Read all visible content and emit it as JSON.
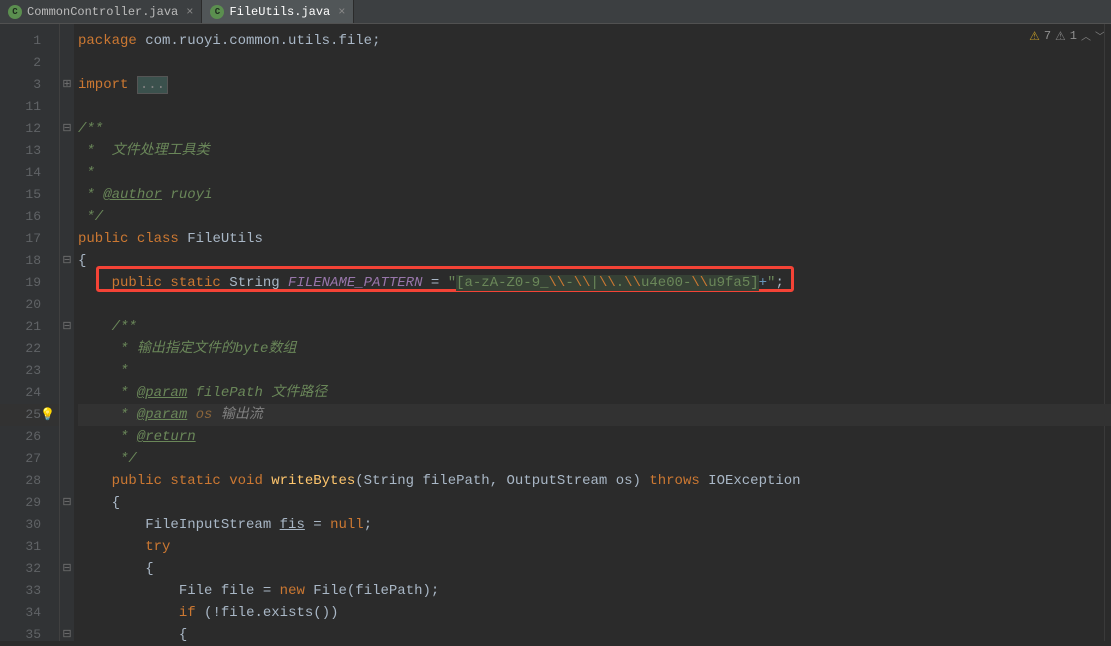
{
  "tabs": [
    {
      "name": "CommonController.java",
      "active": false
    },
    {
      "name": "FileUtils.java",
      "active": true
    }
  ],
  "inspections": {
    "warn7": "7",
    "warn1": "1"
  },
  "gutter": [
    "1",
    "2",
    "3",
    "11",
    "12",
    "13",
    "14",
    "15",
    "16",
    "17",
    "18",
    "19",
    "20",
    "21",
    "22",
    "23",
    "24",
    "25",
    "26",
    "27",
    "28",
    "29",
    "30",
    "31",
    "32",
    "33",
    "34",
    "35"
  ],
  "code": {
    "pkg_kw": "package ",
    "pkg_name": "com.ruoyi.common.utils.file",
    "semicolon": ";",
    "import_kw": "import ",
    "import_folded": "...",
    "doc_open": "/**",
    "doc_l1": " *  文件处理工具类",
    "doc_star": " *",
    "doc_author_pre": " * ",
    "doc_author_tag": "@author",
    "doc_author_val": " ruoyi",
    "doc_close": " */",
    "public": "public ",
    "class": "class ",
    "classname": "FileUtils",
    "lbrace": "{",
    "rbrace": "}",
    "static": "static ",
    "string_t": "String ",
    "field_name": "FILENAME_PATTERN",
    "eq": " = ",
    "regex_q1": "\"",
    "regex_p1": "[a-zA-Z0-9_",
    "regex_e1": "\\\\",
    "regex_p2": "-",
    "regex_e2": "\\\\",
    "regex_p3": "|",
    "regex_e3": "\\\\",
    "regex_p4": ".",
    "regex_e4": "\\\\",
    "regex_p5": "u4e00-",
    "regex_e5": "\\\\",
    "regex_p6": "u9fa5]",
    "regex_plus": "+",
    "regex_q2": "\"",
    "doc2_l1": " * 输出指定文件的byte数组",
    "doc2_param_tag": "@param",
    "doc2_param1": " filePath 文件路径",
    "doc2_param2_name": " os",
    "doc2_param2_desc": " 输出流",
    "doc2_return_tag": "@return",
    "void": "void ",
    "method_name": "writeBytes",
    "lparen": "(",
    "rparen": ")",
    "param1_type": "String ",
    "param1_name": "filePath",
    "comma": ", ",
    "param2_type": "OutputStream ",
    "param2_name": "os",
    "throws": " throws ",
    "exc": "IOException",
    "fis_type": "FileInputStream ",
    "fis_name": "fis",
    "null": "null",
    "try": "try",
    "file_type": "File ",
    "file_var": "file ",
    "new": "new ",
    "file_ctor": "File",
    "if": "if ",
    "not": "!",
    "file_ref": "file",
    "dot": ".",
    "exists": "exists",
    "empty_paren": "()"
  }
}
